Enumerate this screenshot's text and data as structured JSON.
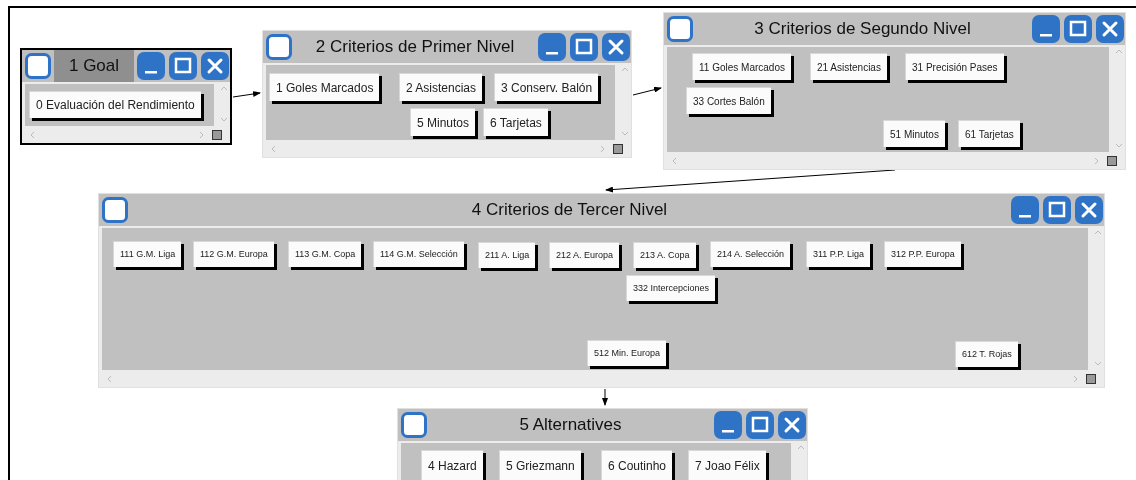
{
  "windows": [
    {
      "title": "1 Goal",
      "selected": true,
      "items": [
        "0 Evaluación del Rendimiento"
      ]
    },
    {
      "title": "2 Criterios de Primer Nivel",
      "selected": false,
      "items": [
        "1 Goles Marcados",
        "2 Asistencias",
        "3 Conserv. Balón",
        "5 Minutos",
        "6 Tarjetas"
      ]
    },
    {
      "title": "3 Criterios de Segundo Nivel",
      "selected": false,
      "items": [
        "11 Goles Marcados",
        "21 Asistencias",
        "31 Precisión Pases",
        "33 Cortes Balón",
        "51 Minutos",
        "61 Tarjetas"
      ]
    },
    {
      "title": "4 Criterios de Tercer Nivel",
      "selected": false,
      "items": [
        "111 G.M. Liga",
        "112 G.M. Europa",
        "113 G.M. Copa",
        "114 G.M. Selección",
        "211 A. Liga",
        "212 A. Europa",
        "213 A. Copa",
        "214 A. Selección",
        "311 P.P. Liga",
        "312 P.P. Europa",
        "332 Intercepciones",
        "512 Min. Europa",
        "612 T. Rojas"
      ]
    },
    {
      "title": "5 Alternatives",
      "selected": false,
      "items": [
        "4 Hazard",
        "5 Griezmann",
        "6 Coutinho",
        "7 Joao Félix"
      ]
    }
  ]
}
